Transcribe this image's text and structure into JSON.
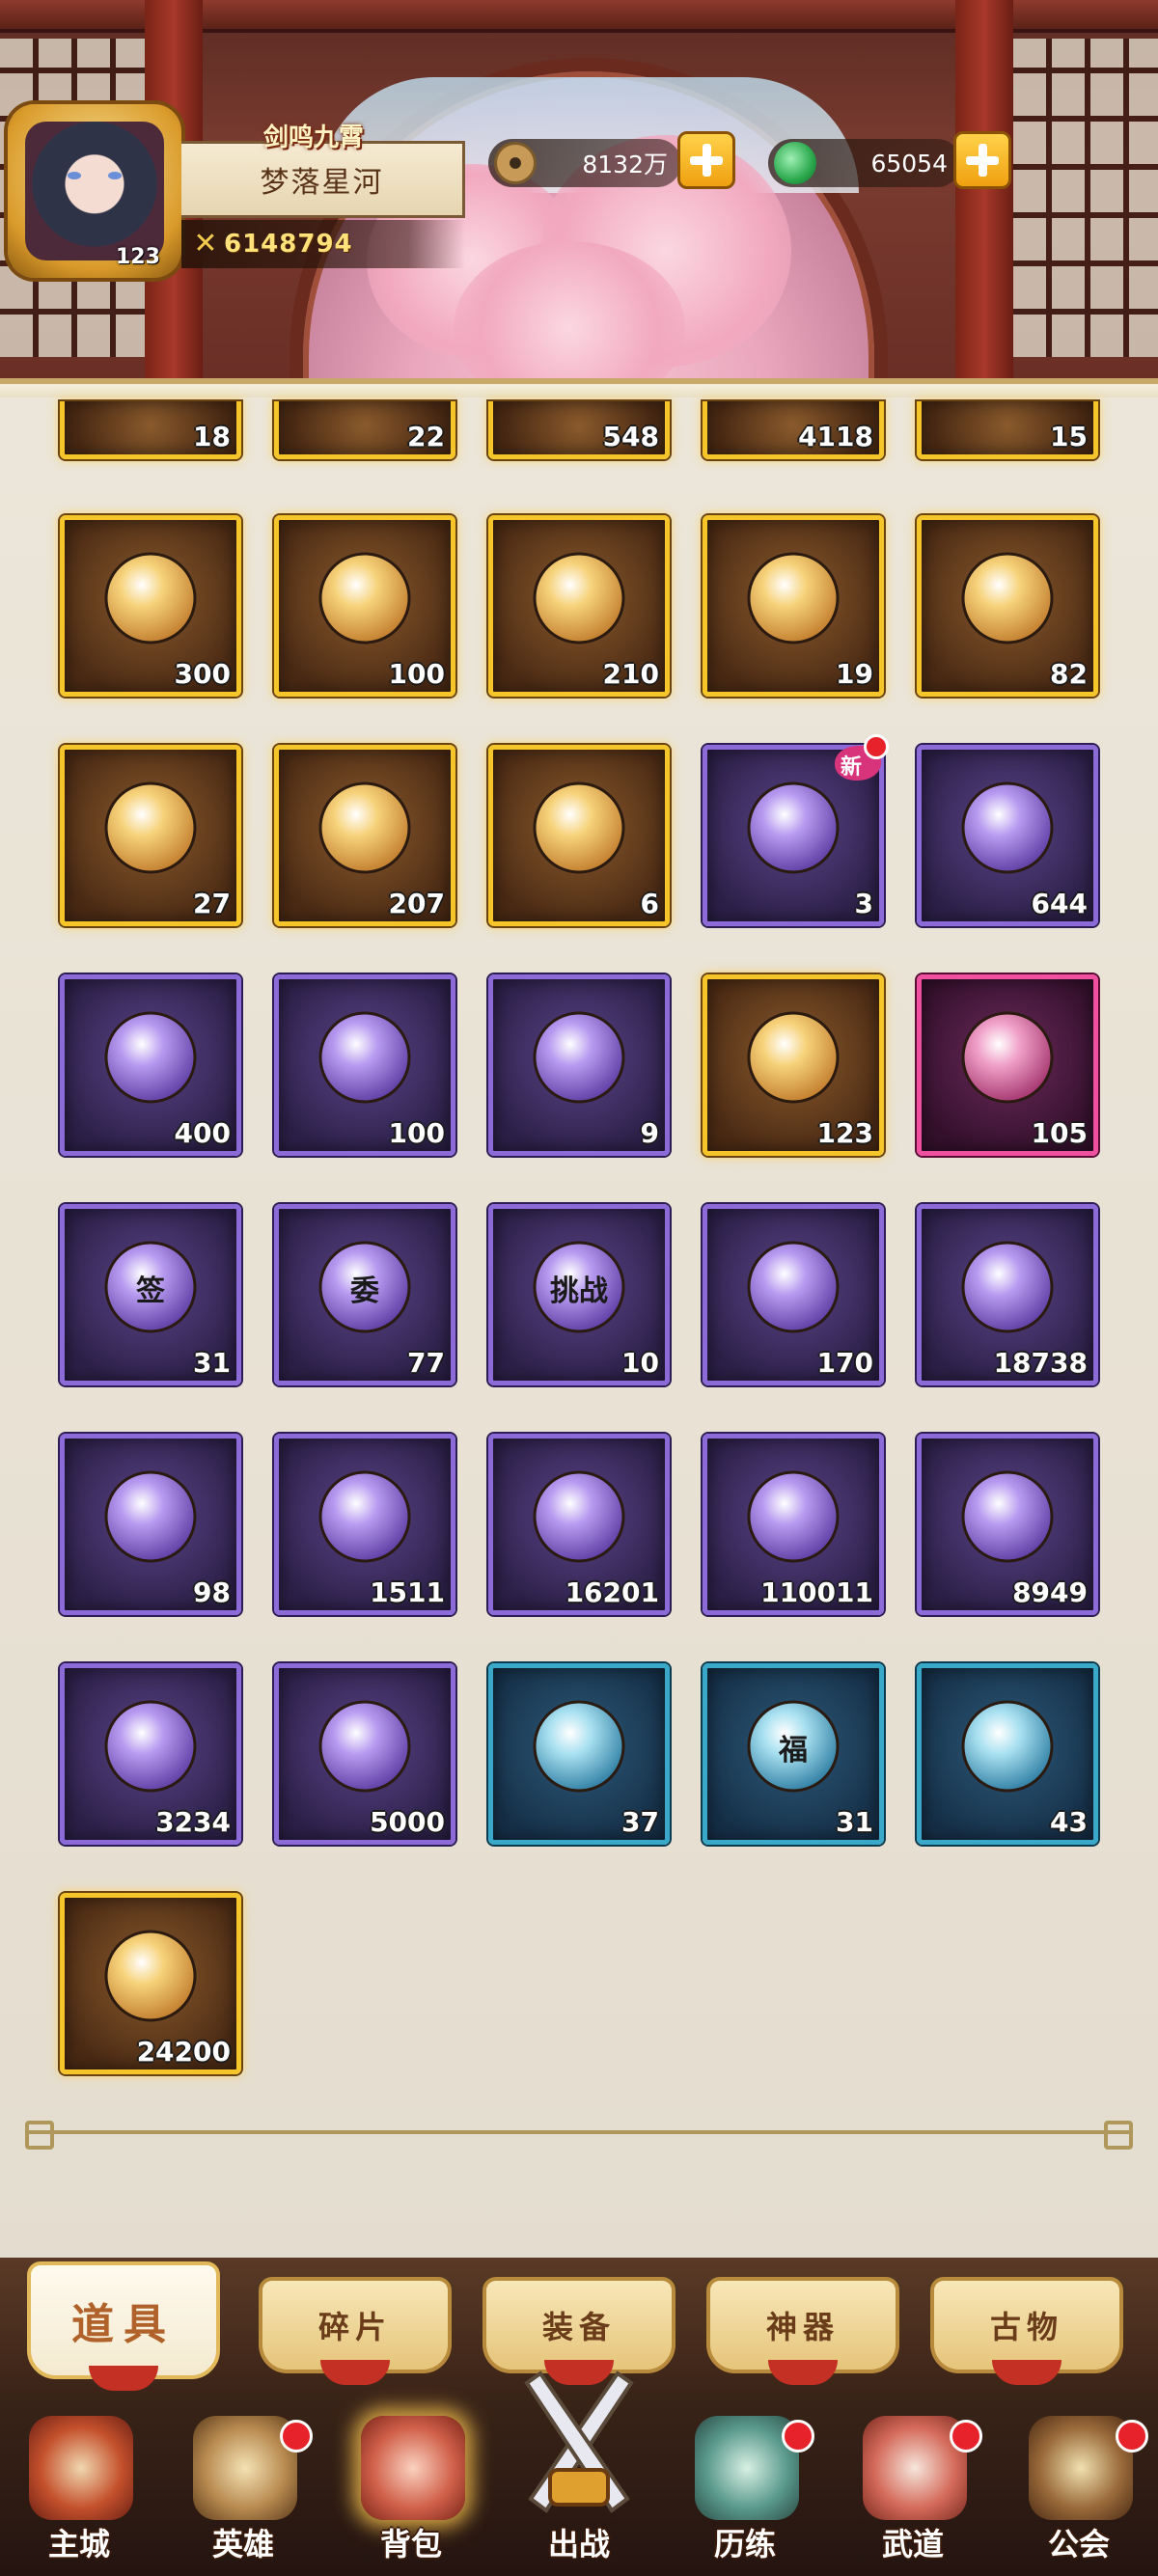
{
  "player": {
    "name": "梦落星河",
    "level": "123",
    "power": "6148794",
    "game_logo": "剑鸣九霄"
  },
  "currencies": [
    {
      "name": "coin",
      "icon": "copper-coin-icon",
      "value": "8132万"
    },
    {
      "name": "jade",
      "icon": "jade-icon",
      "value": "65054"
    }
  ],
  "partial_row": [
    "18",
    "22",
    "548",
    "4118",
    "15"
  ],
  "items": [
    {
      "qty": "300",
      "rarity": "gold",
      "icon": "blue-crystal-icon"
    },
    {
      "qty": "100",
      "rarity": "gold",
      "icon": "gold-medallion-icon"
    },
    {
      "qty": "210",
      "rarity": "gold",
      "icon": "dagger-icon"
    },
    {
      "qty": "19",
      "rarity": "gold",
      "icon": "fire-swirl-orb-icon"
    },
    {
      "qty": "82",
      "rarity": "gold",
      "icon": "bagua-icon"
    },
    {
      "qty": "27",
      "rarity": "gold",
      "icon": "stone-plate-icon"
    },
    {
      "qty": "207",
      "rarity": "gold",
      "icon": "bottle-icon"
    },
    {
      "qty": "6",
      "rarity": "gold",
      "icon": "flame-orb-icon"
    },
    {
      "qty": "3",
      "rarity": "purple",
      "icon": "lucky-bag-icon",
      "new": "新"
    },
    {
      "qty": "644",
      "rarity": "purple",
      "icon": "go-stones-icon"
    },
    {
      "qty": "400",
      "rarity": "purple",
      "icon": "red-scroll-icon"
    },
    {
      "qty": "100",
      "rarity": "purple",
      "icon": "blue-gem-icon"
    },
    {
      "qty": "9",
      "rarity": "purple",
      "icon": "red-bead-icon"
    },
    {
      "qty": "123",
      "rarity": "gold",
      "icon": "rainbow-star-icon"
    },
    {
      "qty": "105",
      "rarity": "pink",
      "icon": "jade-ruyi-icon"
    },
    {
      "qty": "31",
      "rarity": "purple",
      "icon": "lot-tag-icon",
      "glyph": "签"
    },
    {
      "qty": "77",
      "rarity": "purple",
      "icon": "commission-card-icon",
      "glyph": "委"
    },
    {
      "qty": "10",
      "rarity": "purple",
      "icon": "challenge-card-icon",
      "glyph": "挑战"
    },
    {
      "qty": "170",
      "rarity": "purple",
      "icon": "scroll-medal-icon"
    },
    {
      "qty": "18738",
      "rarity": "purple",
      "icon": "spirit-stone-icon"
    },
    {
      "qty": "98",
      "rarity": "purple",
      "icon": "fire-swirl-orb-icon"
    },
    {
      "qty": "1511",
      "rarity": "purple",
      "icon": "flame-paw-icon"
    },
    {
      "qty": "16201",
      "rarity": "purple",
      "icon": "paw-amber-icon"
    },
    {
      "qty": "110011",
      "rarity": "purple",
      "icon": "ice-crystal-icon"
    },
    {
      "qty": "8949",
      "rarity": "purple",
      "icon": "crimson-orb-icon"
    },
    {
      "qty": "3234",
      "rarity": "purple",
      "icon": "iron-ore-icon"
    },
    {
      "qty": "5000",
      "rarity": "purple",
      "icon": "frost-crystal-icon"
    },
    {
      "qty": "37",
      "rarity": "blue",
      "icon": "white-flowers-icon"
    },
    {
      "qty": "31",
      "rarity": "blue",
      "icon": "fortune-fan-icon",
      "glyph": "福"
    },
    {
      "qty": "43",
      "rarity": "blue",
      "icon": "wine-jar-icon"
    },
    {
      "qty": "24200",
      "rarity": "gold",
      "icon": "dragon-emblem-icon"
    }
  ],
  "category_tabs": [
    {
      "label": "道具",
      "active": true
    },
    {
      "label": "碎片",
      "active": false
    },
    {
      "label": "装备",
      "active": false
    },
    {
      "label": "神器",
      "active": false
    },
    {
      "label": "古物",
      "active": false
    }
  ],
  "nav": [
    {
      "label": "主城",
      "icon": "city-gate-icon",
      "dot": false,
      "active": false
    },
    {
      "label": "英雄",
      "icon": "hero-hat-icon",
      "dot": true,
      "active": false
    },
    {
      "label": "背包",
      "icon": "backpack-icon",
      "dot": false,
      "active": true
    },
    {
      "label": "出战",
      "icon": "crossed-swords-icon",
      "dot": false,
      "active": false
    },
    {
      "label": "历练",
      "icon": "training-icon",
      "dot": true,
      "active": false
    },
    {
      "label": "武道",
      "icon": "martial-drum-icon",
      "dot": true,
      "active": false
    },
    {
      "label": "公会",
      "icon": "guild-icon",
      "dot": true,
      "active": false
    }
  ]
}
